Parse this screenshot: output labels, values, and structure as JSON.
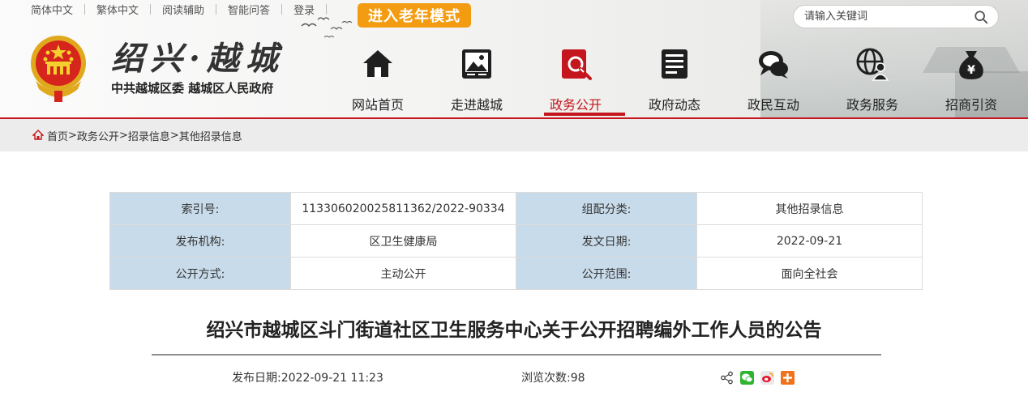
{
  "toplinks": [
    "简体中文",
    "繁体中文",
    "阅读辅助",
    "智能问答",
    "登录"
  ],
  "oldmode_label": "进入老年模式",
  "search": {
    "placeholder": "请输入关键词"
  },
  "brand": {
    "title": "绍兴·越城",
    "subtitle": "中共越城区委 越城区人民政府"
  },
  "nav": [
    {
      "label": "网站首页",
      "icon": "home-icon"
    },
    {
      "label": "走进越城",
      "icon": "picture-icon"
    },
    {
      "label": "政务公开",
      "icon": "document-search-icon",
      "active": true
    },
    {
      "label": "政府动态",
      "icon": "news-icon"
    },
    {
      "label": "政民互动",
      "icon": "chat-icon"
    },
    {
      "label": "政务服务",
      "icon": "globe-user-icon"
    },
    {
      "label": "招商引资",
      "icon": "money-bag-icon"
    }
  ],
  "breadcrumb": [
    "首页",
    ">",
    "政务公开",
    ">",
    "招录信息",
    ">",
    "其他招录信息"
  ],
  "info": {
    "index_label": "索引号:",
    "index_value": "11330602002581136​2/2022-90334",
    "category_label": "组配分类:",
    "category_value": "其他招录信息",
    "org_label": "发布机构:",
    "org_value": "区卫生健康局",
    "date_label": "发文日期:",
    "date_value": "2022-09-21",
    "mode_label": "公开方式:",
    "mode_value": "主动公开",
    "scope_label": "公开范围:",
    "scope_value": "面向全社会"
  },
  "article": {
    "title": "绍兴市越城区斗门街道社区卫生服务中心关于公开招聘编外工作人员的公告",
    "publish_label": "发布日期:",
    "publish_value": "2022-09-21 11:23",
    "views_label": "浏览次数:",
    "views_value": "98"
  },
  "colors": {
    "accent": "#c4161c",
    "oldmode": "#f39c11",
    "table_key_bg": "#c8dbea"
  }
}
